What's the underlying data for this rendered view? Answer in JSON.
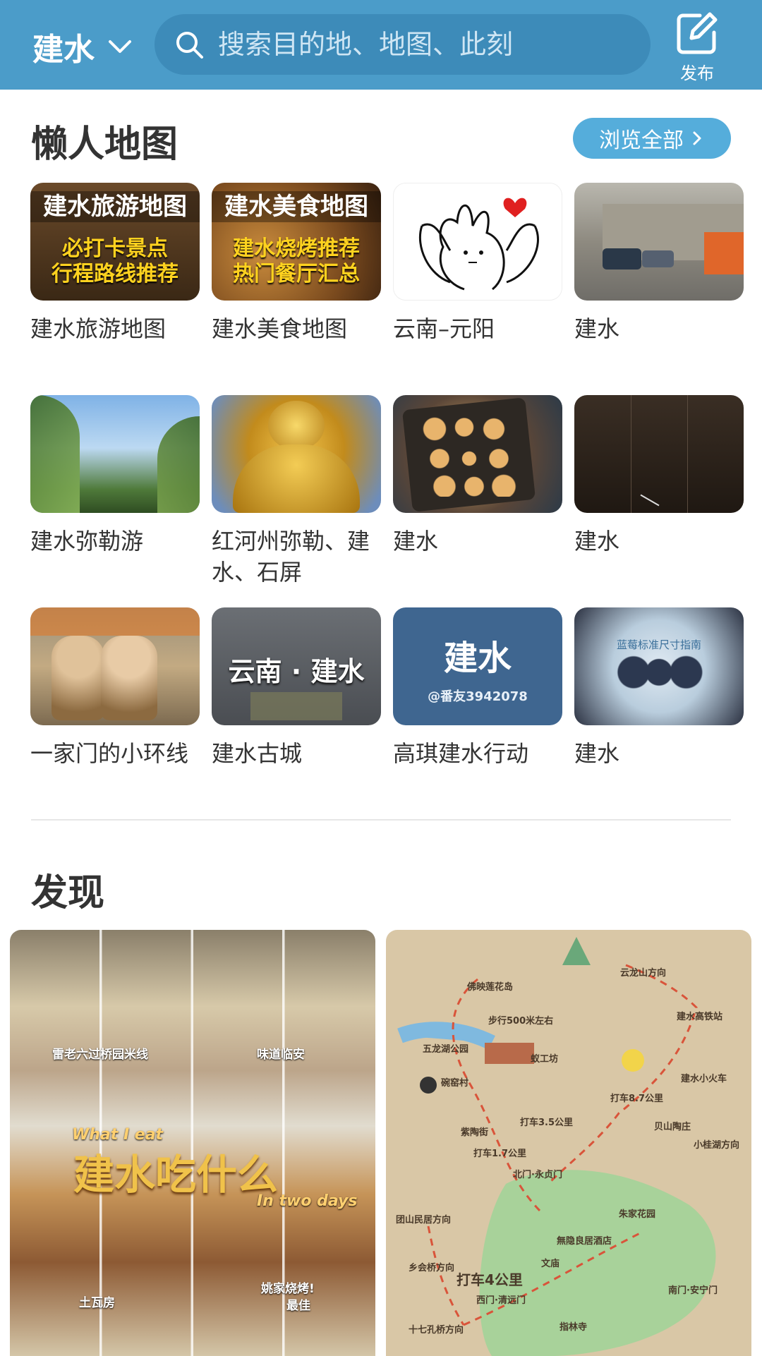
{
  "header": {
    "city": "建水",
    "search_placeholder": "搜索目的地、地图、此刻",
    "publish_label": "发布"
  },
  "lazy_maps": {
    "title": "懒人地图",
    "browse_all": "浏览全部",
    "cards": [
      {
        "caption": "建水旅游地图",
        "overlay_title": "建水旅游地图",
        "overlay_sub1": "必打卡景点",
        "overlay_sub2": "行程路线推荐"
      },
      {
        "caption": "建水美食地图",
        "overlay_title": "建水美食地图",
        "overlay_sub1": "建水烧烤推荐",
        "overlay_sub2": "热门餐厅汇总"
      },
      {
        "caption": "云南–元阳"
      },
      {
        "caption": "建水"
      },
      {
        "caption": "建水弥勒游"
      },
      {
        "caption": "红河州弥勒、建水、石屏"
      },
      {
        "caption": "建水"
      },
      {
        "caption": "建水"
      },
      {
        "caption": "一家门的小环线"
      },
      {
        "caption": "建水古城",
        "overlay_city": "云南 · 建水"
      },
      {
        "caption": "高琪建水行动",
        "overlay_big": "建水",
        "overlay_small": "@番友3942078"
      },
      {
        "caption": "建水",
        "overlay_berry": "蓝莓标准尺寸指南"
      }
    ]
  },
  "discover": {
    "title": "发现",
    "left_post": {
      "label1": "雷老六过桥园米线",
      "label2": "味道临安",
      "what_i_eat": "What I eat",
      "main": "建水吃什么",
      "in_two_days": "In two days",
      "label3": "土瓦房",
      "label4": "姚家烧烤!",
      "label5": "最佳"
    },
    "right_post": {
      "places": [
        "云龙山方向",
        "佛映莲花岛",
        "步行500米左右",
        "建水高铁站",
        "五龙湖公园",
        "蚁工坊",
        "碗窑村",
        "建水小火车",
        "打车8.7公里",
        "打车3.5公里",
        "紫陶街",
        "贝山陶庄",
        "打车1.7公里",
        "小桂湖方向",
        "北门·永贞门",
        "团山民居方向",
        "朱家花园",
        "無隐良居酒店",
        "文庙",
        "乡会桥方向",
        "打车4公里",
        "西门·清远门",
        "十七孔桥方向",
        "指林寺",
        "南门·安宁门"
      ]
    }
  }
}
